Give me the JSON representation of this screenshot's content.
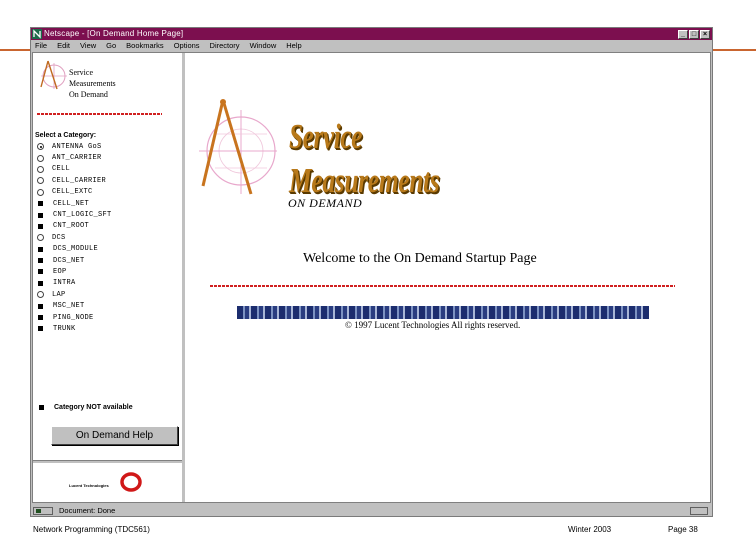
{
  "window": {
    "title": "Netscape - [On Demand Home Page]",
    "controls": {
      "minimize": "_",
      "maximize": "□",
      "close": "×"
    }
  },
  "menu": [
    "File",
    "Edit",
    "View",
    "Go",
    "Bookmarks",
    "Options",
    "Directory",
    "Window",
    "Help"
  ],
  "sidebar": {
    "brand_lines": [
      "Service",
      "Measurements",
      "On Demand"
    ],
    "select_label": "Select a Category:",
    "categories": [
      {
        "label": "ANTENNA GoS",
        "available": true,
        "checked": true
      },
      {
        "label": "ANT_CARRIER",
        "available": true,
        "checked": false
      },
      {
        "label": "CELL",
        "available": true,
        "checked": false
      },
      {
        "label": "CELL_CARRIER",
        "available": true,
        "checked": false
      },
      {
        "label": "CELL_EXTC",
        "available": true,
        "checked": false
      },
      {
        "label": "CELL_NET",
        "available": false,
        "checked": false
      },
      {
        "label": "CNT_LOGIC_SFT",
        "available": false,
        "checked": false
      },
      {
        "label": "CNT_ROOT",
        "available": false,
        "checked": false
      },
      {
        "label": "DCS",
        "available": true,
        "checked": false
      },
      {
        "label": "DCS_MODULE",
        "available": false,
        "checked": false
      },
      {
        "label": "DCS_NET",
        "available": false,
        "checked": false
      },
      {
        "label": "EOP",
        "available": false,
        "checked": false
      },
      {
        "label": "INTRA",
        "available": false,
        "checked": false
      },
      {
        "label": "LAP",
        "available": true,
        "checked": false
      },
      {
        "label": "MSC_NET",
        "available": false,
        "checked": false
      },
      {
        "label": "PING_NODE",
        "available": false,
        "checked": false
      },
      {
        "label": "TRUNK",
        "available": false,
        "checked": false
      }
    ],
    "not_available_label": "Category NOT available",
    "help_button": "On Demand Help",
    "lucent_text": "Lucent Technologies"
  },
  "main": {
    "brand_title_line1": "Service",
    "brand_title_line2": "Measurements",
    "brand_subtitle": "ON DEMAND",
    "welcome": "Welcome to the On Demand Startup Page",
    "copyright": "© 1997 Lucent Technologies  All rights reserved."
  },
  "status": {
    "text": "Document: Done"
  },
  "footer": {
    "left": "Network Programming (TDC561)",
    "middle": "Winter  2003",
    "right": "Page 38"
  },
  "colors": {
    "titlebar": "#7c0f4f",
    "brand_gold": "#b8791a",
    "rule_red": "#d02020",
    "slide_rule_orange": "#c9652f"
  },
  "icons": {
    "app": "netscape-icon",
    "logo": "compass-logo-icon",
    "lucent": "lucent-ring-icon"
  }
}
